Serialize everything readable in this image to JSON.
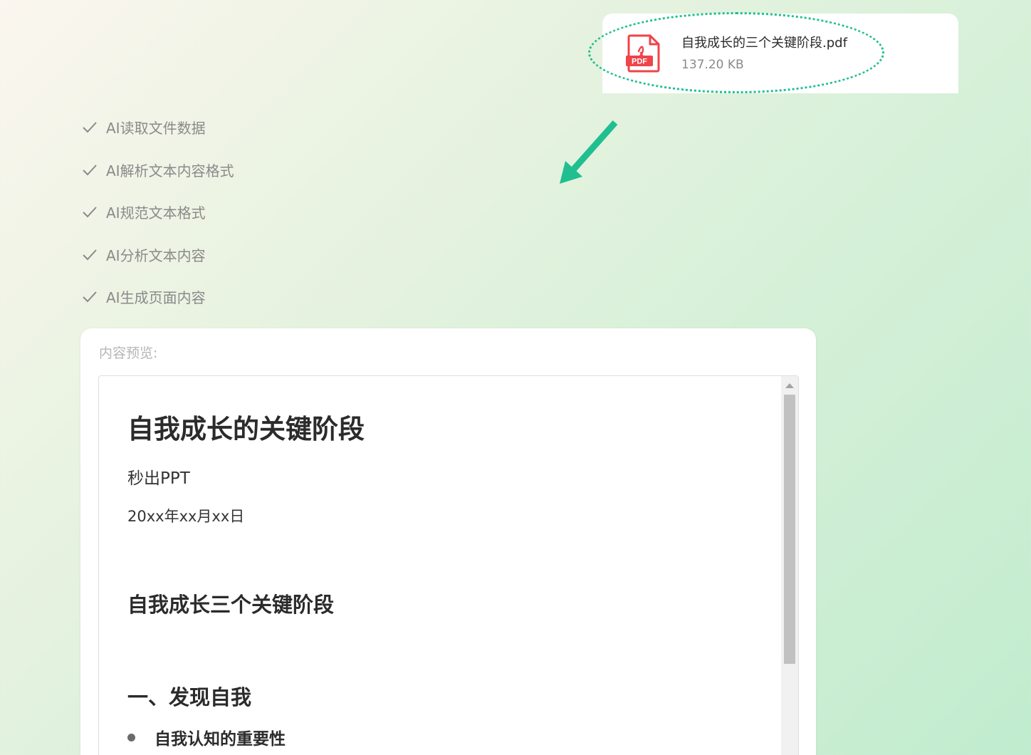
{
  "file": {
    "name": "自我成长的三个关键阶段.pdf",
    "size": "137.20 KB",
    "icon": "pdf-file-icon",
    "icon_label": "PDF",
    "icon_color": "#f0434a",
    "highlight_color": "#1fbf8f"
  },
  "steps": [
    {
      "label": "AI读取文件数据",
      "status": "done"
    },
    {
      "label": "AI解析文本内容格式",
      "status": "done"
    },
    {
      "label": "AI规范文本格式",
      "status": "done"
    },
    {
      "label": "AI分析文本内容",
      "status": "done"
    },
    {
      "label": "AI生成页面内容",
      "status": "done"
    }
  ],
  "preview": {
    "title": "内容预览:",
    "doc": {
      "h1": "自我成长的关键阶段",
      "subtitle": "秒出PPT",
      "date": "20xx年xx月xx日",
      "h2": "自我成长三个关键阶段",
      "section": "一、发现自我",
      "bullet": "自我认知的重要性"
    }
  },
  "colors": {
    "accent": "#1fbf8f",
    "muted_text": "#8a8a8a",
    "heading_text": "#2b2b2b"
  }
}
